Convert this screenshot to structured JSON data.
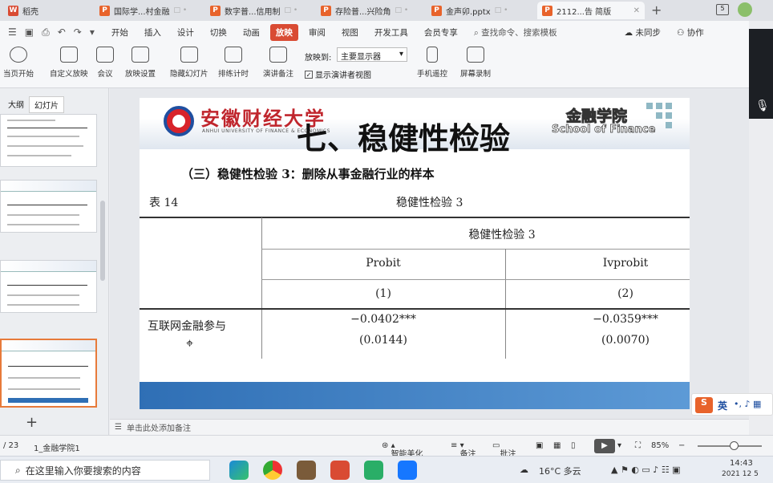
{
  "tabs": [
    {
      "label": "稻壳",
      "color": "#d94b33",
      "icon": "W"
    },
    {
      "label": "国际学...村金融",
      "color": "#e8632b",
      "icon": "P"
    },
    {
      "label": "数字普...信用制",
      "color": "#e8632b",
      "icon": "P"
    },
    {
      "label": "存险普...兴险角",
      "color": "#e8632b",
      "icon": "P"
    },
    {
      "label": "金声卯.pptx",
      "color": "#e8632b",
      "icon": "P"
    },
    {
      "label": "2112...告 简版",
      "color": "#e8632b",
      "icon": "P"
    }
  ],
  "menu": [
    "开始",
    "插入",
    "设计",
    "切换",
    "动画",
    "放映",
    "审阅",
    "视图",
    "开发工具",
    "会员专享"
  ],
  "menu_active": "放映",
  "menu_search": "查找命令、搜索模板",
  "menu_right": [
    "未同步",
    "协作"
  ],
  "toolbar": {
    "tools": [
      "当页开始",
      "自定义放映",
      "会议",
      "放映设置",
      "隐藏幻灯片",
      "排练计时",
      "演讲备注",
      "手机遥控",
      "屏幕录制"
    ],
    "display_label": "放映到:",
    "display_value": "主要显示器",
    "presenter_view": "显示演讲者视图"
  },
  "sidepanel": {
    "tab_outline": "大纲",
    "tab_slides": "幻灯片",
    "add_symbol": "+"
  },
  "slide": {
    "univ_name": "安徽财经大学",
    "univ_sub": "ANHUI UNIVERSITY OF FINANCE & ECONOMICS",
    "title": "七、稳健性检验",
    "school_cn": "金融学院",
    "school_en": "School of Finance",
    "section_heading": "（三）稳健性检验 3：删除从事金融行业的样本",
    "table_label": "表 14",
    "table_title": "稳健性检验 3",
    "table": {
      "group_header": "稳健性检验 3",
      "columns": [
        "Probit",
        "Ivprobit"
      ],
      "col_numbers": [
        "(1)",
        "(2)"
      ],
      "rows": [
        {
          "label": "互联网金融参与",
          "values": [
            "−0.0402***",
            "−0.0359***"
          ],
          "se": [
            "(0.0144)",
            "(0.0070)"
          ]
        }
      ]
    }
  },
  "notes_placeholder": "单击此处添加备注",
  "status": {
    "slide_index": "/ 23",
    "theme": "1_金融学院1",
    "beautify": "智能美化",
    "remarks": "备注",
    "comments": "批注",
    "zoom": "85%"
  },
  "taskbar": {
    "search_placeholder": "在这里输入你要搜索的内容",
    "weather": "16°C 多云",
    "time": "14:43",
    "date": "2021 12 5"
  },
  "ime_label": "英"
}
